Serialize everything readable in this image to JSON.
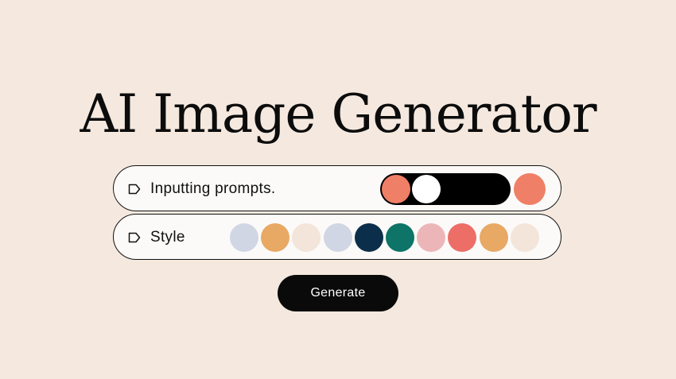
{
  "page": {
    "title": "AI Image Generator",
    "background": "#f5e9df"
  },
  "prompt_row": {
    "label": "Inputting prompts.",
    "icon": "tag-icon",
    "toggle": {
      "state": "on",
      "knob_left_color": "#ef7f66",
      "knob_right_color": "#ffffff",
      "track_color": "#000000"
    },
    "swatch_color": "#ef7f66"
  },
  "style_row": {
    "label": "Style",
    "icon": "tag-icon",
    "swatches": [
      {
        "name": "light-blue-gray",
        "color": "#d1d6e4"
      },
      {
        "name": "orange",
        "color": "#e8a965"
      },
      {
        "name": "cream",
        "color": "#f3e5d9"
      },
      {
        "name": "light-blue-gray-2",
        "color": "#d1d6e4"
      },
      {
        "name": "navy",
        "color": "#0b2f4a"
      },
      {
        "name": "teal",
        "color": "#0d7467"
      },
      {
        "name": "pink",
        "color": "#ecb6b9"
      },
      {
        "name": "coral-red",
        "color": "#ec6e66"
      },
      {
        "name": "orange-2",
        "color": "#e8a965"
      },
      {
        "name": "cream-2",
        "color": "#f3e5d9"
      }
    ]
  },
  "actions": {
    "generate_label": "Generate"
  }
}
